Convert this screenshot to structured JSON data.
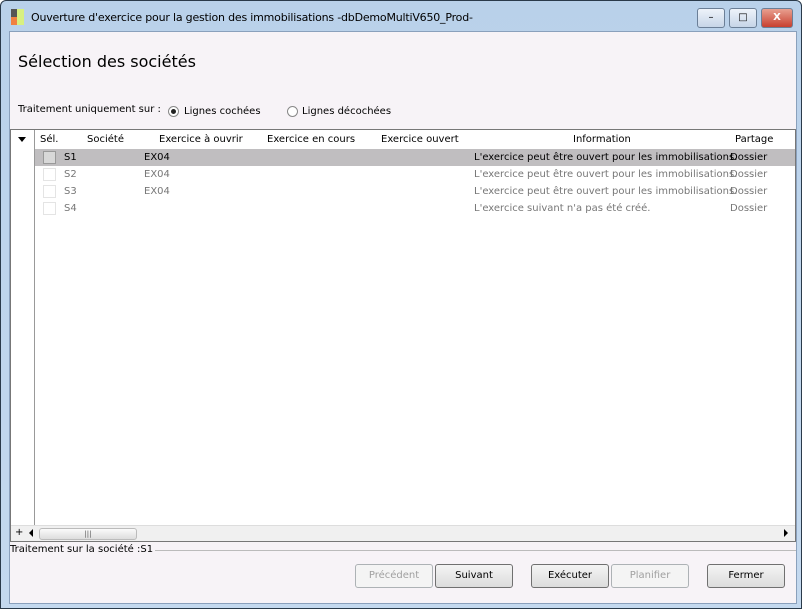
{
  "window": {
    "title": "Ouverture d'exercice pour la gestion des immobilisations -dbDemoMultiV650_Prod-",
    "minimize": "–",
    "maximize": "□",
    "close": "X"
  },
  "page_title": "Sélection des sociétés",
  "filter": {
    "label": "Traitement uniquement sur :",
    "options": [
      {
        "label": "Lignes cochées",
        "selected": true
      },
      {
        "label": "Lignes décochées",
        "selected": false
      }
    ]
  },
  "grid": {
    "columns": [
      "Sél.",
      "Société",
      "Exercice à ouvrir",
      "Exercice en cours",
      "Exercice ouvert",
      "Information",
      "Partage"
    ],
    "rows": [
      {
        "societe": "S1",
        "a_ouvrir": "EX04",
        "en_cours": "",
        "ouvert": "",
        "information": "L'exercice peut être ouvert pour les immobilisations.",
        "partage": "Dossier",
        "checked": false,
        "selected": true
      },
      {
        "societe": "S2",
        "a_ouvrir": "EX04",
        "en_cours": "",
        "ouvert": "",
        "information": "L'exercice peut être ouvert pour les immobilisations.",
        "partage": "Dossier",
        "checked": false,
        "selected": false
      },
      {
        "societe": "S3",
        "a_ouvrir": "EX04",
        "en_cours": "",
        "ouvert": "",
        "information": "L'exercice peut être ouvert pour les immobilisations.",
        "partage": "Dossier",
        "checked": false,
        "selected": false
      },
      {
        "societe": "S4",
        "a_ouvrir": "",
        "en_cours": "",
        "ouvert": "",
        "information": "L'exercice suivant n'a pas été créé.",
        "partage": "Dossier",
        "checked": false,
        "selected": false
      }
    ],
    "expand": "+"
  },
  "status": "Traitement sur la société :S1",
  "buttons": {
    "previous": "Précédent",
    "next": "Suivant",
    "execute": "Exécuter",
    "schedule": "Planifier",
    "close": "Fermer"
  }
}
